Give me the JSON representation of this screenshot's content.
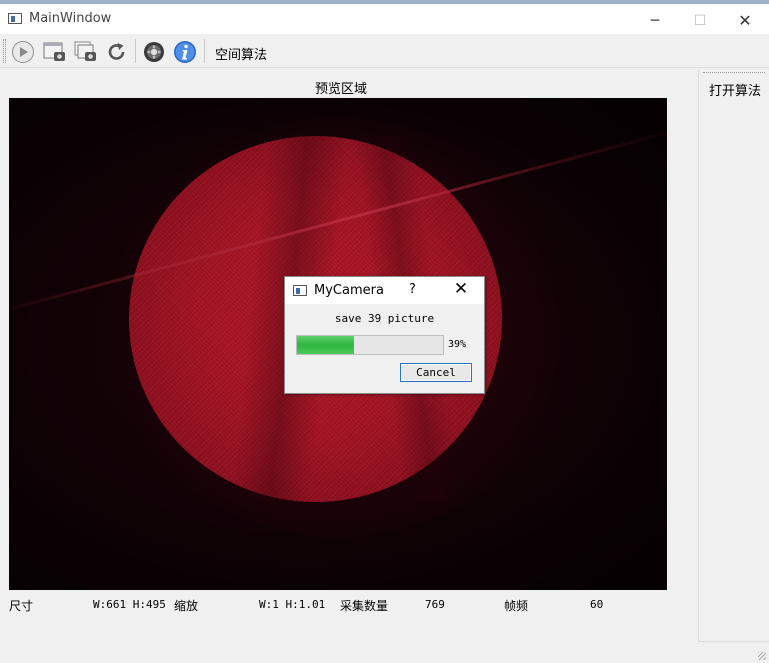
{
  "window": {
    "title": "MainWindow"
  },
  "titlebar_buttons": {
    "minimize": "─",
    "maximize": "☐",
    "close": "✕"
  },
  "toolbar": {
    "icons": [
      "play-icon",
      "capture-icon",
      "save-images-icon",
      "refresh-icon",
      "settings-icon",
      "info-icon"
    ],
    "algo_label": "空间算法"
  },
  "preview": {
    "label": "预览区域"
  },
  "right_panel": {
    "open_algo_label": "打开算法"
  },
  "status": {
    "size_label": "尺寸",
    "size_value": "W:661 H:495",
    "zoom_label": "缩放",
    "zoom_value": "W:1 H:1.01",
    "count_label": "采集数量",
    "count_value": "769",
    "fps_label": "帧频",
    "fps_value": "60"
  },
  "dialog": {
    "title": "MyCamera",
    "help": "?",
    "close": "✕",
    "message": "save 39 picture",
    "progress": 39,
    "progress_text": "39%",
    "cancel_label": "Cancel"
  },
  "colors": {
    "progress_fill": "#2fb640",
    "accent": "#2a6fc7",
    "preview_disk": "#a51525"
  }
}
